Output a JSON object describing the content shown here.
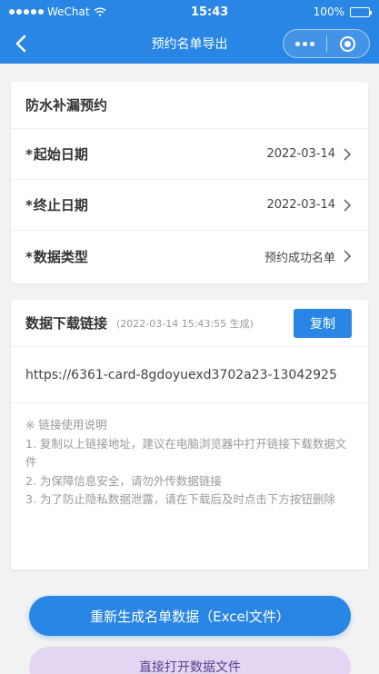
{
  "status_bar": {
    "carrier": "WeChat",
    "time": "15:43",
    "battery": "100%"
  },
  "nav": {
    "title": "预约名单导出"
  },
  "form": {
    "title": "防水补漏预约",
    "rows": [
      {
        "label": "起始日期",
        "value": "2022-03-14"
      },
      {
        "label": "终止日期",
        "value": "2022-03-14"
      },
      {
        "label": "数据类型",
        "value": "预约成功名单"
      }
    ]
  },
  "download": {
    "title": "数据下载链接",
    "generated": "(2022-03-14 15:43:55 生成)",
    "copy_label": "复制",
    "link": "https://6361-card-8gdoyuexd3702a23-13042925",
    "notes": [
      "※ 链接使用说明",
      "1. 复制以上链接地址，建议在电脑浏览器中打开链接下载数据文件",
      "2. 为保障信息安全，请勿外传数据链接",
      "3. 为了防止隐私数据泄露，请在下载后及时点击下方按钮删除"
    ]
  },
  "actions": {
    "regenerate_label": "重新生成名单数据（Excel文件）",
    "open_label": "直接打开数据文件"
  },
  "colors": {
    "primary": "#2a86e4",
    "secondary_bg": "#e3d6f3",
    "secondary_text": "#5a3f8f"
  }
}
